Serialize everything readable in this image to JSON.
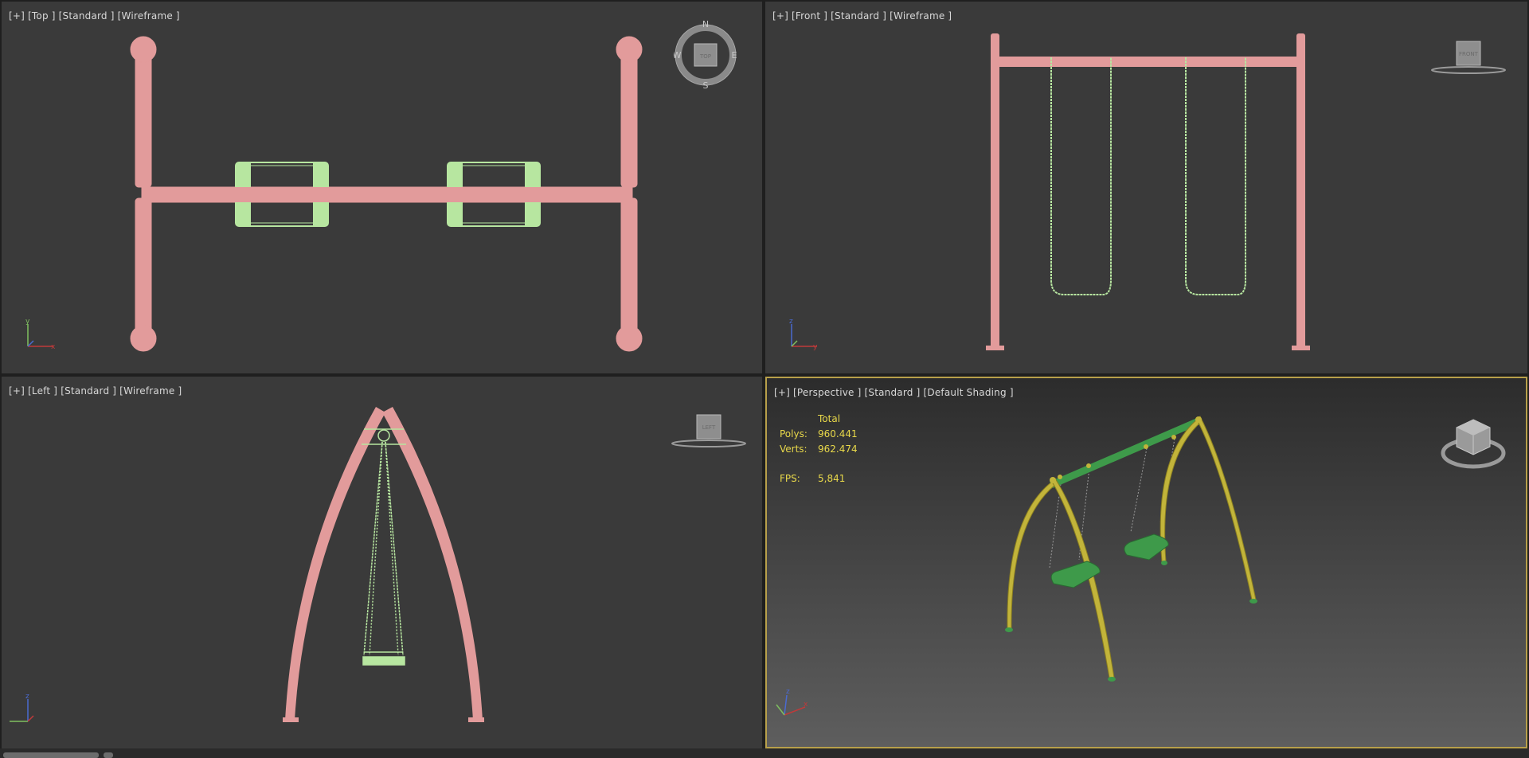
{
  "viewports": {
    "top": {
      "label": "[+] [Top ] [Standard ] [Wireframe ]"
    },
    "front": {
      "label": "[+] [Front ] [Standard ] [Wireframe ]"
    },
    "left": {
      "label": "[+] [Left ] [Standard ] [Wireframe ]"
    },
    "persp": {
      "label": "[+] [Perspective ] [Standard ] [Default Shading ]"
    }
  },
  "viewcube": {
    "top_face": "TOP",
    "front_face": "FRONT",
    "left_face": "LEFT",
    "compass": {
      "n": "N",
      "s": "S",
      "e": "E",
      "w": "W"
    }
  },
  "axes": {
    "x": "x",
    "y": "y",
    "z": "z"
  },
  "stats": {
    "header": "Total",
    "polys_label": "Polys:",
    "polys_value": "960.441",
    "verts_label": "Verts:",
    "verts_value": "962.474",
    "fps_label": "FPS:",
    "fps_value": "5,841"
  },
  "colors": {
    "viewport_bg": "#3a3a3a",
    "frame_wire": "#e29b9b",
    "swing_wire": "#b7e6a0",
    "active_border": "#b8a04a",
    "stats_text": "#e8d84a",
    "frame_shaded": "#c2b43a",
    "crossbar_shaded": "#3e9a4a"
  }
}
